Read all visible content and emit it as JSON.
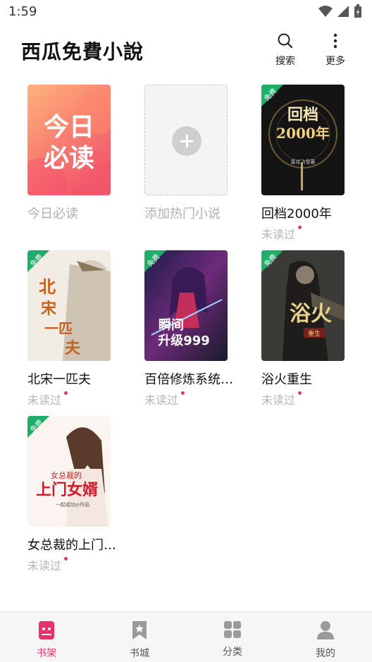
{
  "status_bar": {
    "time": "1:59"
  },
  "header": {
    "title": "西瓜免費小說",
    "search_label": "搜索",
    "more_label": "更多"
  },
  "shelf": {
    "free_badge": "免费",
    "items": [
      {
        "title": "今日必读",
        "status": "",
        "cover_text": "今日\n必读"
      },
      {
        "title": "添加热门小说",
        "status": ""
      },
      {
        "title": "回档2000年",
        "status": "未读过"
      },
      {
        "title": "北宋一匹夫",
        "status": "未读过"
      },
      {
        "title": "百倍修炼系统…",
        "status": "未读过"
      },
      {
        "title": "浴火重生",
        "status": "未读过"
      },
      {
        "title": "女总裁的上门…",
        "status": "未读过"
      }
    ]
  },
  "bottom_nav": {
    "items": [
      {
        "label": "书架",
        "icon": "bookshelf-icon",
        "active": true
      },
      {
        "label": "书城",
        "icon": "bookmark-icon",
        "active": false
      },
      {
        "label": "分类",
        "icon": "grid-icon",
        "active": false
      },
      {
        "label": "我的",
        "icon": "user-icon",
        "active": false
      }
    ]
  },
  "colors": {
    "accent": "#e8336a",
    "free_badge": "#1fae6a"
  }
}
